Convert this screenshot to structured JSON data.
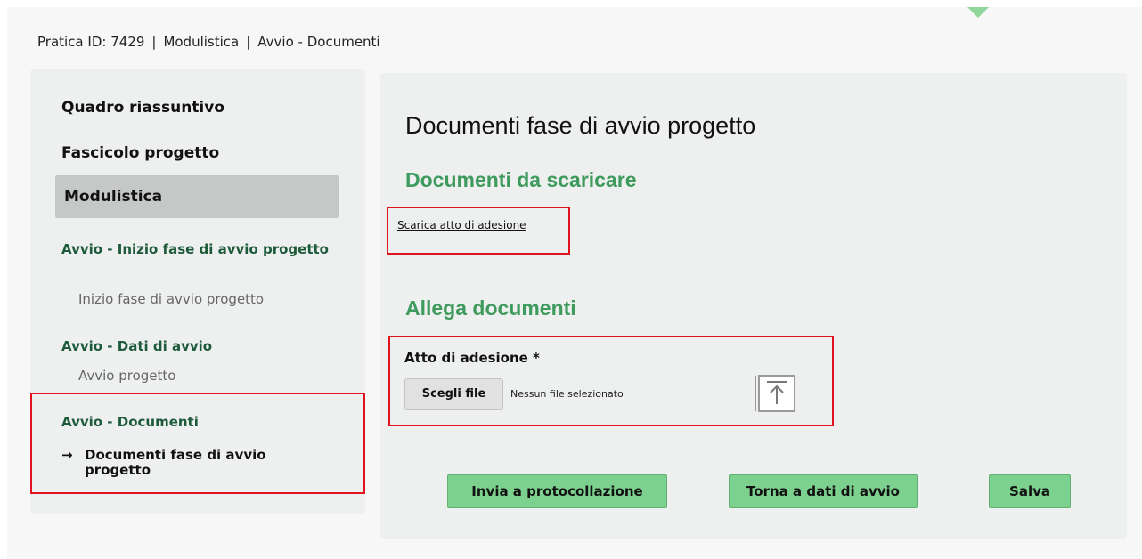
{
  "breadcrumb": {
    "pratica": "Pratica ID: 7429",
    "separator": "|",
    "section": "Modulistica",
    "page": "Avvio - Documenti"
  },
  "sidebar": {
    "items": [
      {
        "label": "Quadro riassuntivo"
      },
      {
        "label": "Fascicolo progetto"
      },
      {
        "label": "Modulistica",
        "active": true
      }
    ],
    "sections": [
      {
        "title": "Avvio - Inizio fase di avvio progetto",
        "sub": "Inizio fase di avvio progetto"
      },
      {
        "title": "Avvio - Dati di avvio",
        "sub": "Avvio progetto"
      },
      {
        "title": "Avvio - Documenti",
        "current": "Documenti fase di avvio progetto",
        "current_marker": "→"
      }
    ]
  },
  "main": {
    "title": "Documenti fase di avvio progetto",
    "download_heading": "Documenti da scaricare",
    "download_link": "Scarica atto di adesione",
    "attach_heading": "Allega documenti",
    "field_label": "Atto di adesione *",
    "file_button": "Scegli file",
    "file_status": "Nessun file selezionato",
    "upload_icon": "upload-arrow-icon"
  },
  "actions": {
    "submit": "Invia a protocollazione",
    "back": "Torna a dati di avvio",
    "save": "Salva"
  },
  "colors": {
    "accent_green": "#3f9a5e",
    "button_green": "#7dd18e",
    "highlight_red": "#e0141e"
  }
}
